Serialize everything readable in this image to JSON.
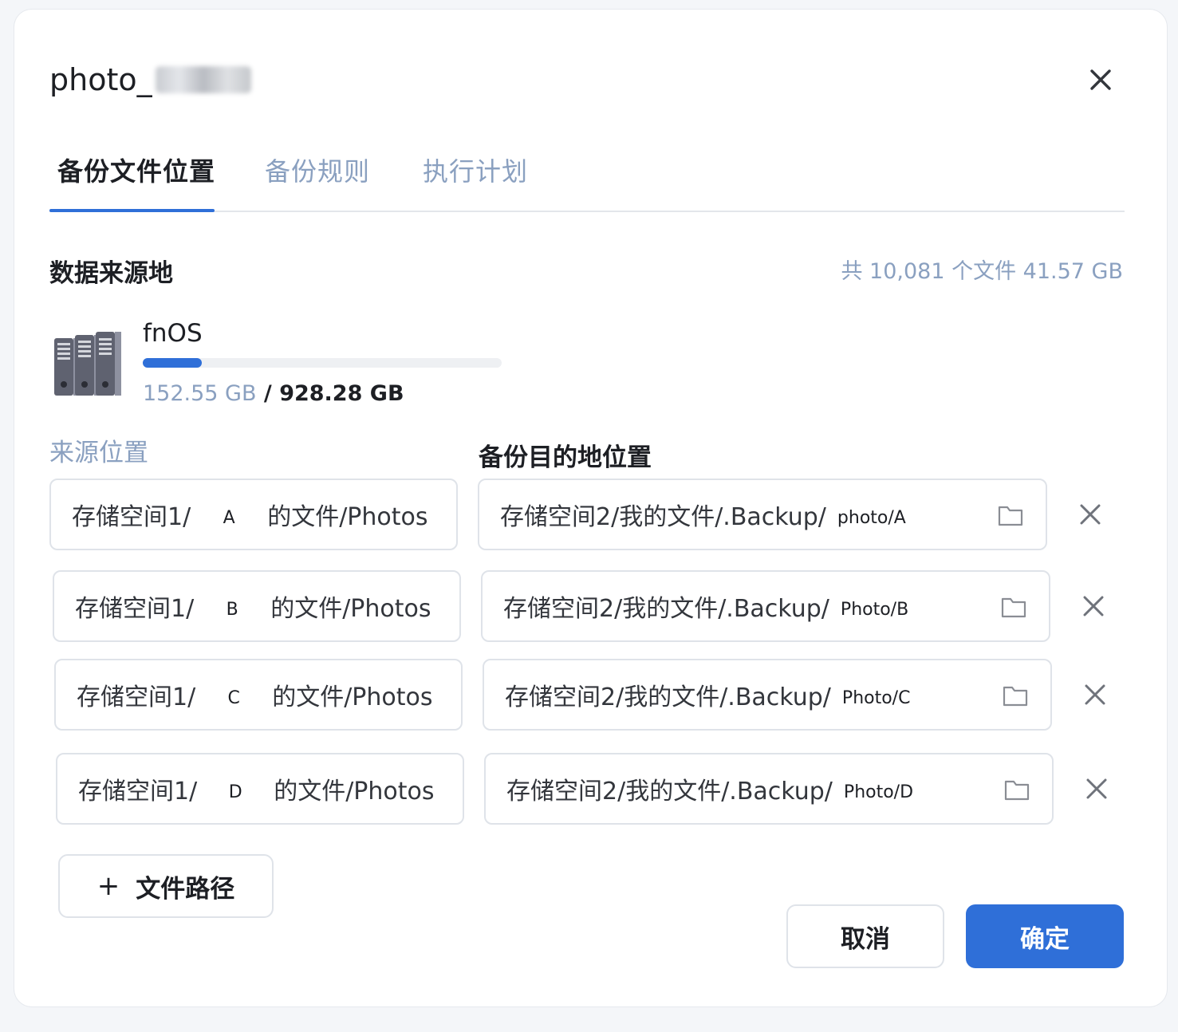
{
  "dialog": {
    "title_prefix": "photo_"
  },
  "tabs": [
    {
      "label": "备份文件位置"
    },
    {
      "label": "备份规则"
    },
    {
      "label": "执行计划"
    }
  ],
  "source": {
    "section_title": "数据来源地",
    "summary": "共 10,081 个文件 41.57 GB",
    "device_name": "fnOS",
    "used": "152.55 GB",
    "separator": " / ",
    "total": "928.28 GB",
    "usage_fraction": 0.164
  },
  "columns": {
    "source_label": "来源位置",
    "dest_label": "备份目的地位置"
  },
  "rows": [
    {
      "src_prefix": "存储空间1/",
      "src_letter": "A",
      "src_suffix": "的文件/Photos",
      "dst_prefix": "存储空间2/我的文件/.Backup/",
      "dst_sub": "photo/A"
    },
    {
      "src_prefix": "存储空间1/",
      "src_letter": "B",
      "src_suffix": "的文件/Photos",
      "dst_prefix": "存储空间2/我的文件/.Backup/",
      "dst_sub": "Photo/B"
    },
    {
      "src_prefix": "存储空间1/",
      "src_letter": "C",
      "src_suffix": "的文件/Photos",
      "dst_prefix": "存储空间2/我的文件/.Backup/",
      "dst_sub": "Photo/C"
    },
    {
      "src_prefix": "存储空间1/",
      "src_letter": "D",
      "src_suffix": "的文件/Photos",
      "dst_prefix": "存储空间2/我的文件/.Backup/",
      "dst_sub": "Photo/D"
    }
  ],
  "actions": {
    "add_path_plus": "+",
    "add_path_label": "文件路径",
    "cancel_label": "取消",
    "confirm_label": "确定"
  },
  "colors": {
    "accent": "#2f6fd8",
    "muted": "#8aa0c0",
    "text": "#1d1f24"
  }
}
